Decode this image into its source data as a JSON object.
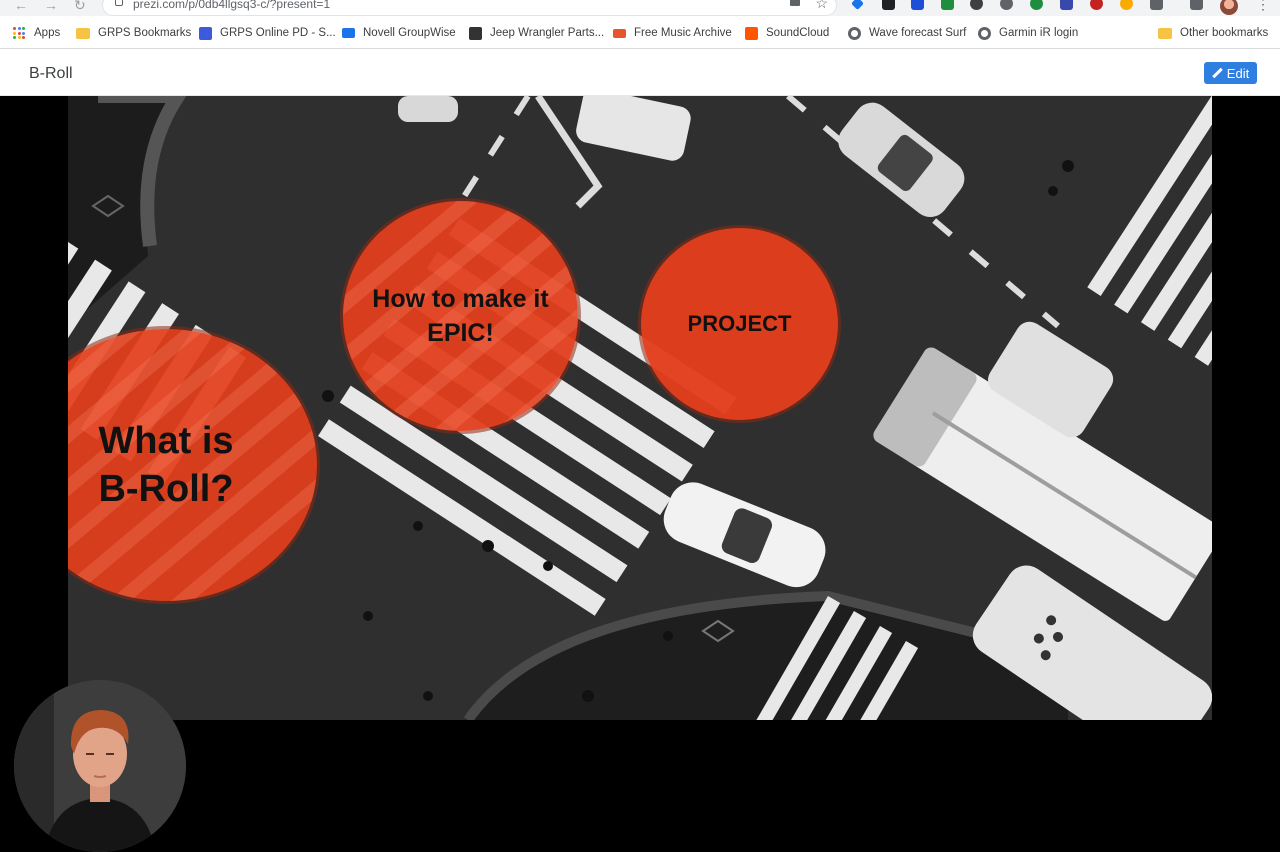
{
  "browser": {
    "url": "prezi.com/p/0db4llgsq3-c/?present=1",
    "bookmarks": [
      {
        "label": "Apps",
        "icon": "apps-grid-icon"
      },
      {
        "label": "GRPS Bookmarks",
        "icon": "folder-icon"
      },
      {
        "label": "GRPS Online PD - S...",
        "icon": "calendar-icon"
      },
      {
        "label": "Novell GroupWise",
        "icon": "mail-icon"
      },
      {
        "label": "Jeep Wrangler Parts...",
        "icon": "jeep-icon"
      },
      {
        "label": "Free Music Archive",
        "icon": "fma-icon"
      },
      {
        "label": "SoundCloud",
        "icon": "soundcloud-icon"
      },
      {
        "label": "Wave forecast Surf",
        "icon": "globe-icon"
      },
      {
        "label": "Garmin iR login",
        "icon": "globe-icon"
      }
    ],
    "other_bookmarks": "Other bookmarks"
  },
  "prezi": {
    "title": "B-Roll",
    "edit_label": "Edit"
  },
  "slide": {
    "circles": {
      "broll": "What is\nB-Roll?",
      "epic": "How to make it\nEPIC!",
      "project": "PROJECT"
    }
  },
  "colors": {
    "accent_red": "#e23e1c",
    "edit_blue": "#2f7fe0"
  }
}
